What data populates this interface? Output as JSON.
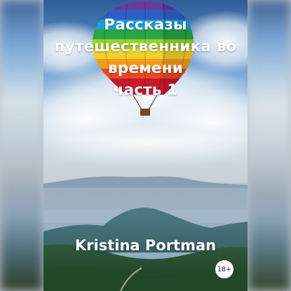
{
  "cover": {
    "title_lines": [
      "Рассказы",
      "путешественника во",
      "времени",
      "часть 1"
    ],
    "author": "Kristina Portman",
    "age_rating": "18+"
  }
}
